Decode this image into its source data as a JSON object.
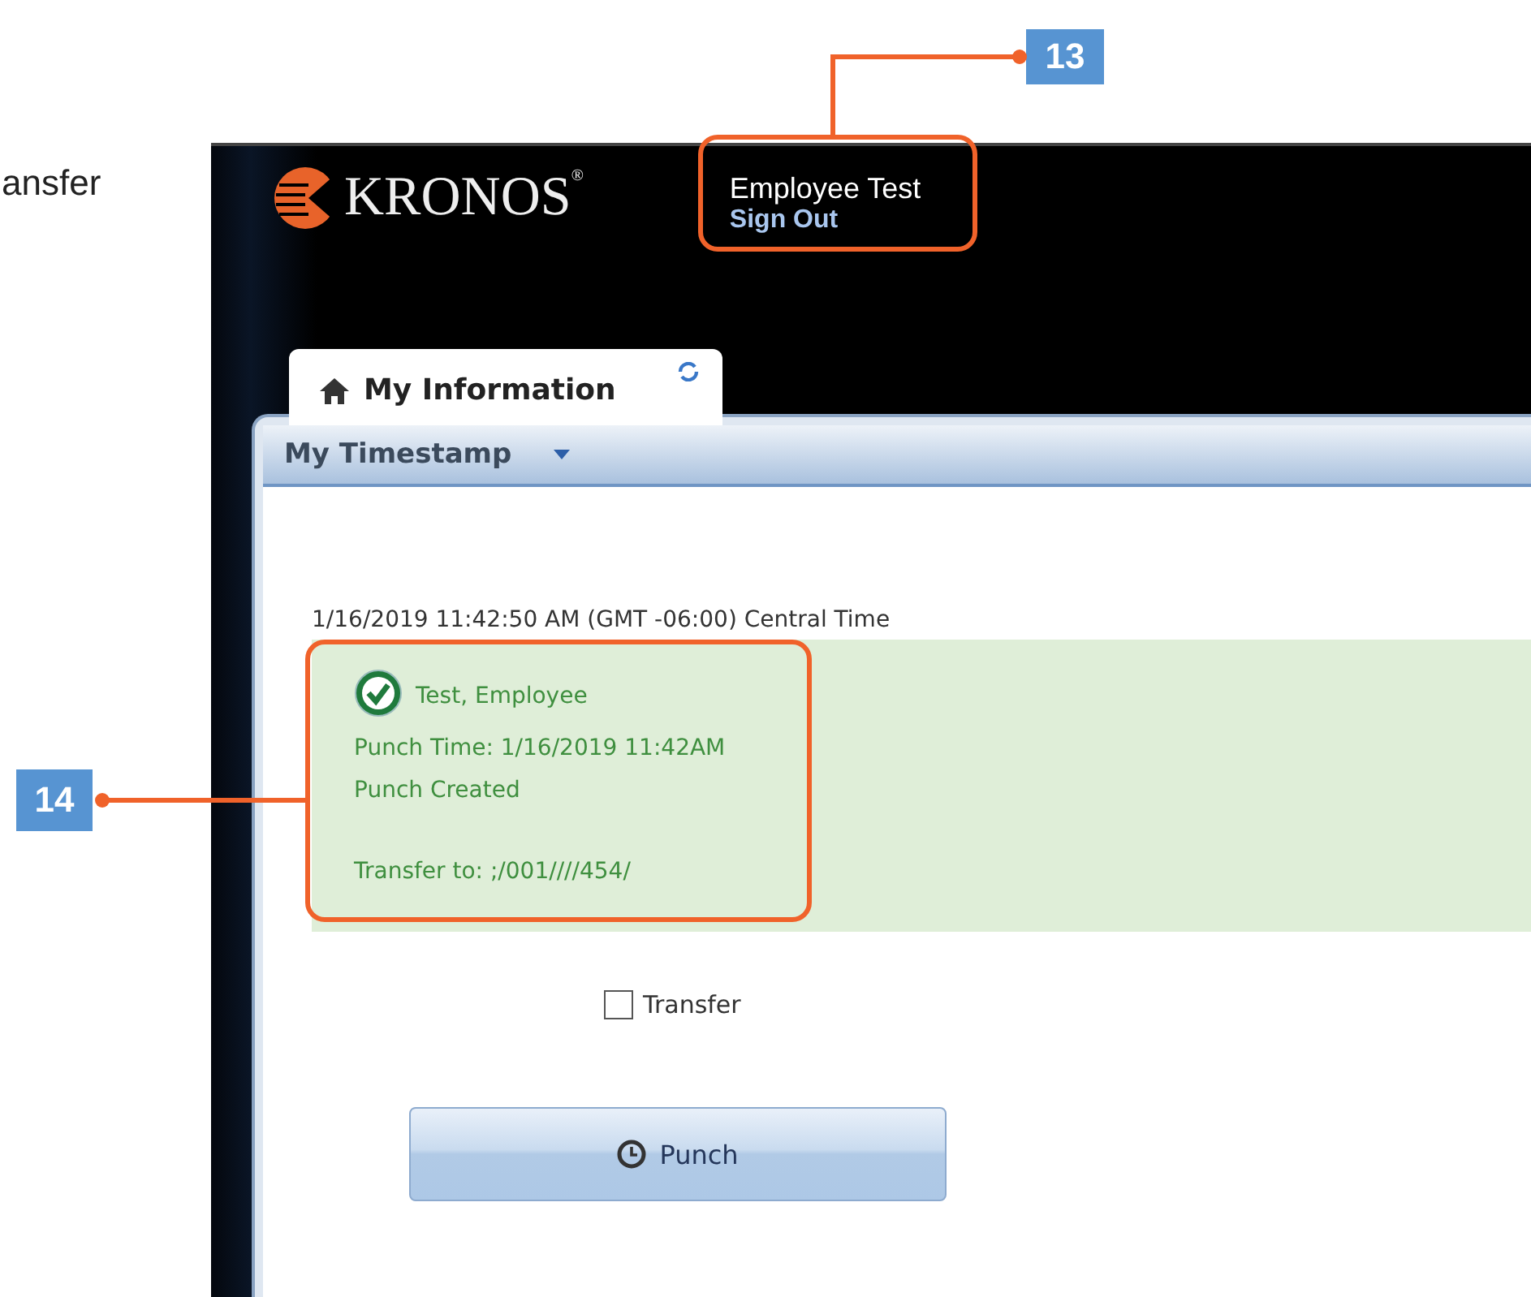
{
  "document_text": "ansfer",
  "app": {
    "logo": "KRONOS$^{®}$",
    "user_name": "Employee Test",
    "sign_out": "Sign Out",
    "tabs": [
      {
        "label": "My Information",
        "selected": true
      }
    ],
    "widget": {
      "title": "My Timestamp",
      "timestamp": "1/16/2019 11:42:50 AM (GMT -06:00) Central Time",
      "result": {
        "name": "Test, Employee",
        "punch_time": "Punch Time: 1/16/2019 11:42AM",
        "status": "Punch Created",
        "transfer": "Transfer to: ;/001////454/"
      },
      "transfer_checkbox": {
        "label": "Transfer",
        "checked": false
      },
      "punch_button": "Punch"
    }
  },
  "callouts": [
    {
      "number": "13"
    },
    {
      "number": "14"
    }
  ]
}
